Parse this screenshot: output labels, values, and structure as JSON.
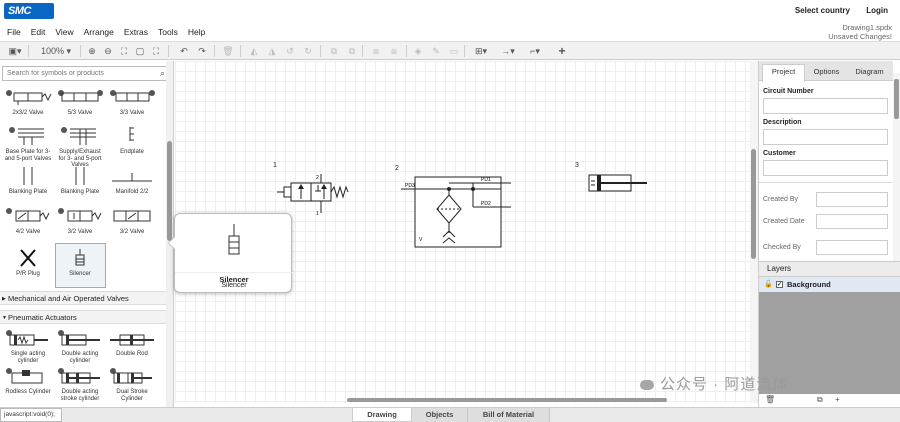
{
  "brand": {
    "logo_text": "SMC"
  },
  "top_links": {
    "select_country": "Select country",
    "login": "Login"
  },
  "menu": [
    "File",
    "Edit",
    "View",
    "Arrange",
    "Extras",
    "Tools",
    "Help"
  ],
  "document": {
    "name": "Drawing1.spdx",
    "status": "Unsaved Changes!"
  },
  "toolbar": {
    "zoom": "100%"
  },
  "sidebar": {
    "search_placeholder": "Search for symbols or products",
    "valves": [
      {
        "label": "2x3/2 Valve"
      },
      {
        "label": "5/3 Valve"
      },
      {
        "label": "3/3 Valve"
      },
      {
        "label": "Base Plate for 3- and 5-port Valves"
      },
      {
        "label": "Supply/Exhaust for 3- and 5-port Valves"
      },
      {
        "label": "Endplate"
      },
      {
        "label": "Blanking Plate"
      },
      {
        "label": "Blanking Plate"
      },
      {
        "label": "Manifold 2/2"
      },
      {
        "label": "4/2 Valve"
      },
      {
        "label": "3/2 Valve"
      },
      {
        "label": "3/2 Valve"
      },
      {
        "label": "P/R Plug"
      },
      {
        "label": "Silencer"
      }
    ],
    "categories": {
      "mechanical": "Mechanical and Air Operated Valves",
      "actuators": "Pneumatic Actuators"
    },
    "actuators": [
      {
        "label": "Single acting cylinder"
      },
      {
        "label": "Double acting cylinder"
      },
      {
        "label": "Double Rod"
      },
      {
        "label": "Rodless Cylinder"
      },
      {
        "label": "Double acting stroke cylinder"
      },
      {
        "label": "Dual Stroke Cylinder"
      }
    ]
  },
  "tooltip": {
    "title": "Silencer",
    "subtitle": "Silencer"
  },
  "canvas": {
    "labels": {
      "n1": "1",
      "n2": "2",
      "n3": "3",
      "pd1": "PD1",
      "pd2": "PD2",
      "pd3": "PD3",
      "v": "V",
      "p2": "2",
      "p1": "1"
    }
  },
  "right_panel": {
    "tabs": [
      "Project",
      "Options",
      "Diagram"
    ],
    "fields": {
      "circuit_number": "Circuit Number",
      "description": "Description",
      "customer": "Customer"
    },
    "meta": {
      "created_by": "Created By",
      "created_date": "Created Date",
      "checked_by": "Checked By"
    },
    "layers_title": "Layers",
    "layer_name": "Background"
  },
  "status": {
    "text": "javascript:void(0);"
  },
  "bottom_tabs": [
    "Drawing",
    "Objects",
    "Bill of Material"
  ],
  "watermark": {
    "text": "公众号 · 阿道流体"
  }
}
